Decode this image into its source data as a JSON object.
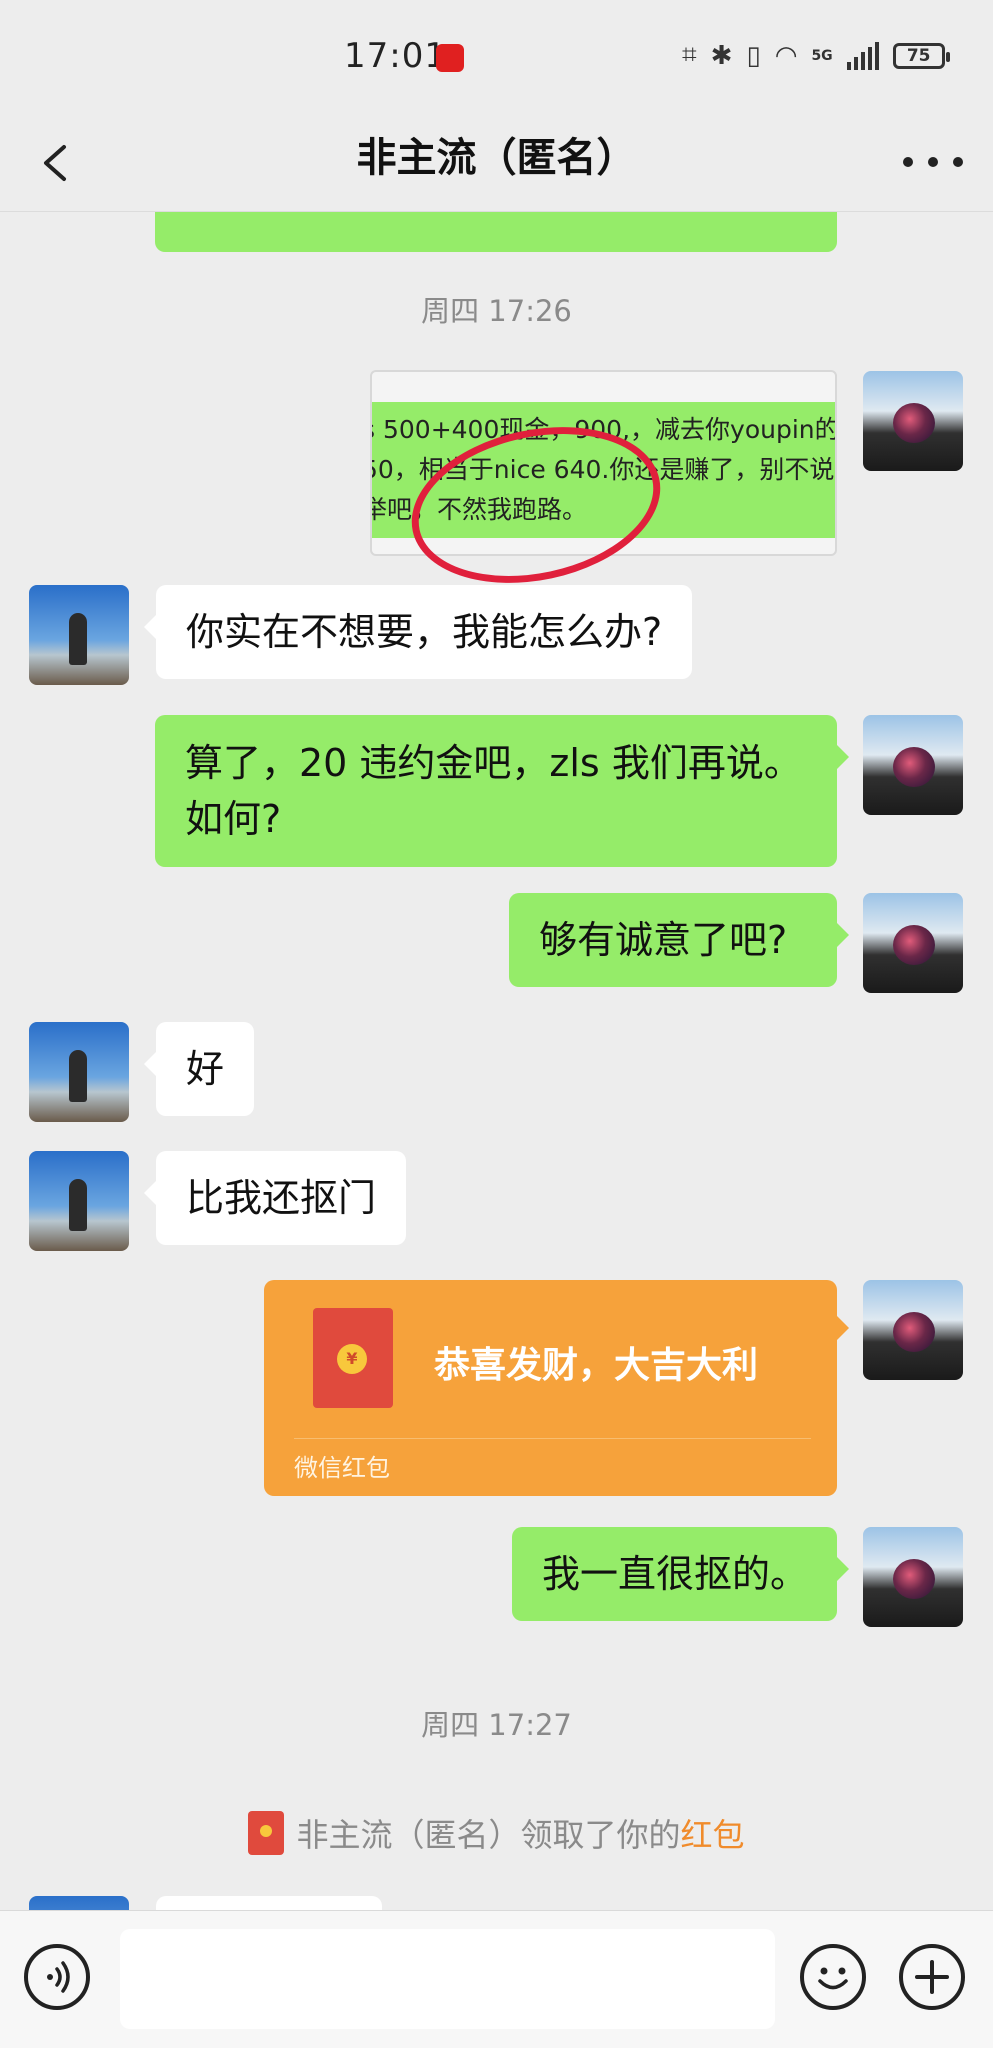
{
  "status_bar": {
    "time": "17:01",
    "battery": "75",
    "network": "5G"
  },
  "nav": {
    "title": "非主流（匿名）"
  },
  "messages": {
    "ts1": "周四 17:26",
    "quote_line1": "s 500+400现金，900,，减去你youpin的",
    "quote_line2": "50，相当于nice 640.你还是赚了，别不说",
    "quote_line3": "举吧，不然我跑路。",
    "m1": "你实在不想要，我能怎么办?",
    "m2": "算了，20 违约金吧，zls 我们再说。如何?",
    "m3": "够有诚意了吧?",
    "m4": "好",
    "m5": "比我还抠门",
    "red_packet_title": "恭喜发财，大吉大利",
    "red_packet_label": "微信红包",
    "red_packet_coin": "¥",
    "m6": "我一直很抠的。",
    "ts2": "周四 17:27",
    "notice_text": "非主流（匿名）领取了你的",
    "notice_link": "红包"
  },
  "colors": {
    "self_bubble": "#95ec69",
    "peer_bubble": "#ffffff",
    "red_packet": "#f6a23b",
    "background": "#ededed"
  }
}
